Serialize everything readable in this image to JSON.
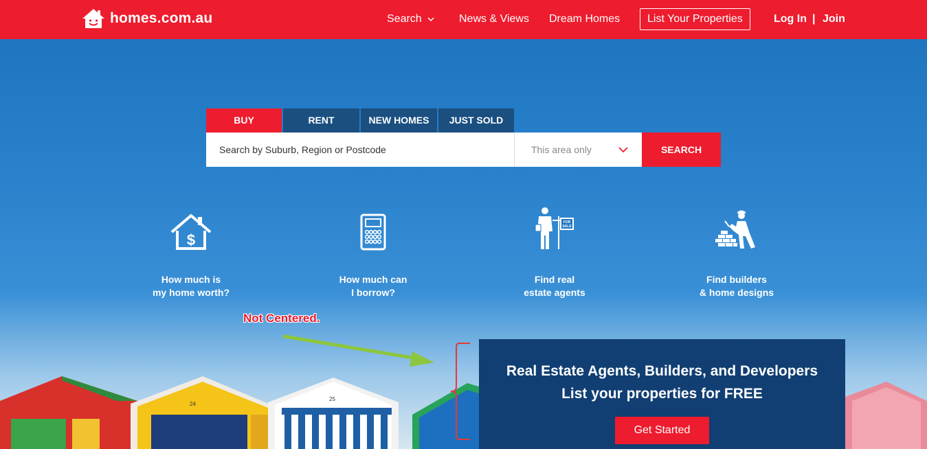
{
  "header": {
    "logo_text": "homes.com.au",
    "nav": {
      "search": "Search",
      "news": "News & Views",
      "dream": "Dream Homes",
      "list": "List Your Properties",
      "login": "Log In",
      "separator": "|",
      "join": "Join"
    }
  },
  "search": {
    "tabs": [
      "BUY",
      "RENT",
      "NEW HOMES",
      "JUST SOLD"
    ],
    "active_tab": "BUY",
    "placeholder": "Search by Suburb, Region or Postcode",
    "area_option": "This area only",
    "button_label": "SEARCH"
  },
  "features": [
    {
      "line1": "How much is",
      "line2": "my home worth?",
      "icon": "house-dollar-icon"
    },
    {
      "line1": "How much can",
      "line2": "I borrow?",
      "icon": "calculator-icon"
    },
    {
      "line1": "Find real",
      "line2": "estate agents",
      "icon": "agent-for-sale-icon",
      "sign_line1": "FOR",
      "sign_line2": "SALE"
    },
    {
      "line1": "Find builders",
      "line2": "& home designs",
      "icon": "builder-bricks-icon"
    }
  ],
  "annotation": {
    "text": "Not Centered."
  },
  "promo": {
    "line1": "Real Estate Agents, Builders, and Developers",
    "line2": "List your properties for FREE",
    "button_label": "Get Started"
  },
  "hut_numbers": [
    "24",
    "25"
  ],
  "colors": {
    "brand_red": "#ed1c2e",
    "tab_blue": "#1a4f80",
    "promo_navy": "#113f73",
    "annotation_red": "#ed1c2e",
    "arrow_green": "#8dc63f"
  }
}
